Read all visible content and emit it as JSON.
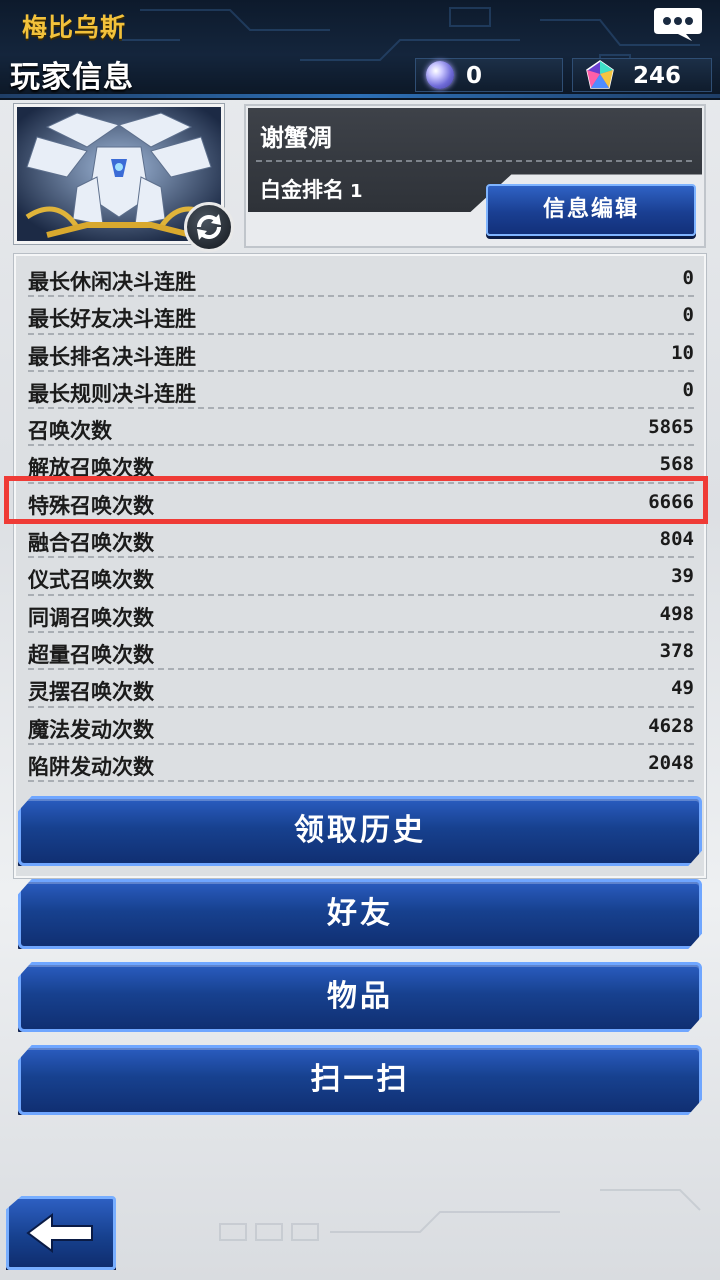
{
  "header": {
    "world_name": "梅比乌斯",
    "page_title": "玩家信息",
    "currency_orb": "0",
    "currency_gem": "246",
    "icons": {
      "orb": "orb-currency-icon",
      "gem": "gem-currency-icon",
      "chat": "chat-icon"
    }
  },
  "profile": {
    "player_name": "谢蟹凋",
    "rank_label": "白金排名",
    "rank_value": "1",
    "edit_button": "信息编辑",
    "icons": {
      "refresh": "refresh-icon"
    }
  },
  "stats": [
    {
      "label": "最长休闲决斗连胜",
      "value": "0"
    },
    {
      "label": "最长好友决斗连胜",
      "value": "0"
    },
    {
      "label": "最长排名决斗连胜",
      "value": "10"
    },
    {
      "label": "最长规则决斗连胜",
      "value": "0"
    },
    {
      "label": "召唤次数",
      "value": "5865"
    },
    {
      "label": "解放召唤次数",
      "value": "568"
    },
    {
      "label": "特殊召唤次数",
      "value": "6666"
    },
    {
      "label": "融合召唤次数",
      "value": "804"
    },
    {
      "label": "仪式召唤次数",
      "value": "39"
    },
    {
      "label": "同调召唤次数",
      "value": "498"
    },
    {
      "label": "超量召唤次数",
      "value": "378"
    },
    {
      "label": "灵摆召唤次数",
      "value": "49"
    },
    {
      "label": "魔法发动次数",
      "value": "4628"
    },
    {
      "label": "陷阱发动次数",
      "value": "2048"
    }
  ],
  "highlighted_stat": "特殊召唤次数",
  "menu": {
    "history": "领取历史",
    "friends": "好友",
    "items": "物品",
    "scan": "扫一扫"
  },
  "colors": {
    "accent_gold": "#f3c23b",
    "button_blue": "#17418f",
    "highlight_red": "#ef3b36"
  },
  "footer": {
    "back_icon": "back-arrow-icon"
  }
}
